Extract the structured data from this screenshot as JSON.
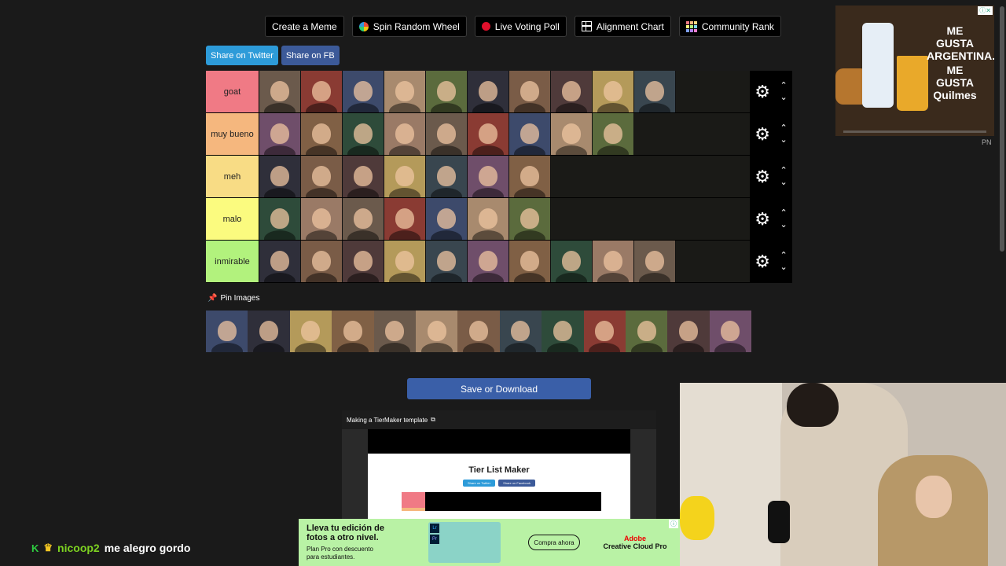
{
  "toolbar": {
    "create_meme": "Create a Meme",
    "spin_wheel": "Spin Random Wheel",
    "live_poll": "Live Voting Poll",
    "alignment": "Alignment Chart",
    "community_rank": "Community Rank"
  },
  "share": {
    "twitter": "Share on Twitter",
    "facebook": "Share on FB"
  },
  "tiers": [
    {
      "label": "goat",
      "color": "#f07a85",
      "count": 10
    },
    {
      "label": "muy bueno",
      "color": "#f5b77e",
      "count": 9
    },
    {
      "label": "meh",
      "color": "#f8dc85",
      "count": 7
    },
    {
      "label": "malo",
      "color": "#fbfb7f",
      "count": 7
    },
    {
      "label": "inmirable",
      "color": "#b2f27d",
      "count": 10
    }
  ],
  "tier_controls": {
    "gear_icon": "gear-icon",
    "up_icon": "chevron-up-icon",
    "down_icon": "chevron-down-icon"
  },
  "pin": {
    "label": "Pin Images",
    "count": 13
  },
  "save_button": "Save or Download",
  "video": {
    "title": "Making a TierMaker template",
    "inner_title": "Tier List Maker",
    "share_twitter": "Share on Twitter",
    "share_facebook": "Share on Facebook"
  },
  "ad_right": {
    "line1": "ME GUSTA ARGENTINA.",
    "line2": "ME GUSTA Quilmes"
  },
  "pn_label": "PN",
  "chat": {
    "badge": "K",
    "user": "nicoop2",
    "message": "me alegro gordo"
  },
  "ad_bottom": {
    "title": "Lleva tu edición de fotos a otro nivel.",
    "subtitle": "Plan Pro con descuento para estudiantes.",
    "cta": "Compra ahora",
    "brand_top": "Adobe",
    "brand": "Creative Cloud Pro"
  },
  "thumb_colors": [
    "#6b5a4c",
    "#8a3b33",
    "#3d4a6b",
    "#a88a6e",
    "#5b6b3d",
    "#2f2f3a",
    "#7a5c47",
    "#4f3a3a",
    "#b49a5a",
    "#39464f",
    "#6f4e6a",
    "#806045",
    "#2e4b3a",
    "#9a7a66"
  ]
}
